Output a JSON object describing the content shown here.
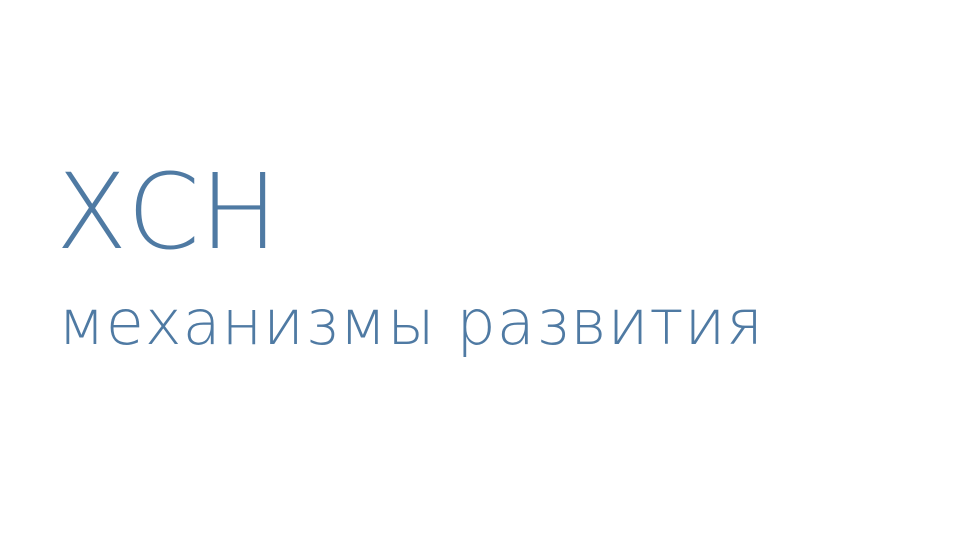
{
  "slide": {
    "title": "ХСН",
    "subtitle": "механизмы развития",
    "text_color": "#4f7aa3",
    "background_color": "#ffffff"
  }
}
